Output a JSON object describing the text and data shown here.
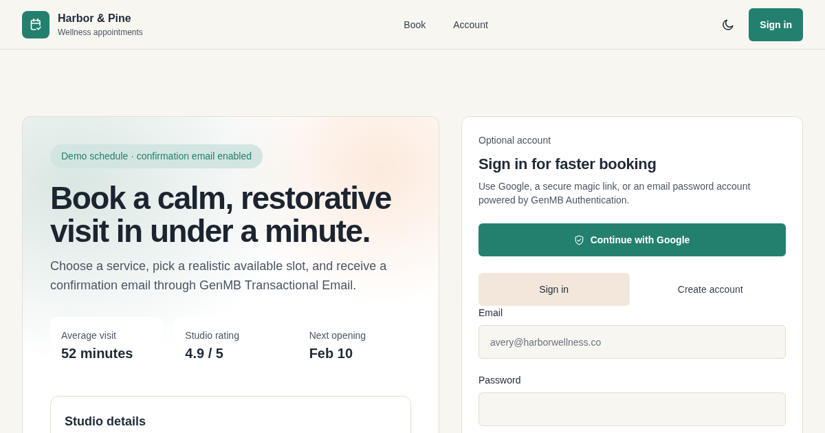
{
  "header": {
    "brand": {
      "name": "Harbor & Pine",
      "tagline": "Wellness appointments"
    },
    "nav": [
      "Book",
      "Account"
    ],
    "sign_in_button": "Sign in"
  },
  "hero": {
    "badge": "Demo schedule · confirmation email enabled",
    "headline": "Book a calm, restorative visit in under a minute.",
    "intro": "Choose a service, pick a realistic available slot, and receive a confirmation email through GenMB Transactional Email.",
    "stats": [
      {
        "label": "Average visit",
        "value": "52 minutes"
      },
      {
        "label": "Studio rating",
        "value": "4.9 / 5"
      },
      {
        "label": "Next opening",
        "value": "Feb 10"
      }
    ],
    "details_card": {
      "title": "Studio details"
    }
  },
  "auth": {
    "eyebrow": "Optional account",
    "title": "Sign in for faster booking",
    "description": "Use Google, a secure magic link, or an email password account powered by GenMB Authentication.",
    "google_button": "Continue with Google",
    "tabs": [
      {
        "label": "Sign in",
        "selected": true
      },
      {
        "label": "Create account",
        "selected": false
      }
    ],
    "fields": [
      {
        "label": "Email",
        "placeholder": "avery@harborwellness.co"
      },
      {
        "label": "Password"
      }
    ]
  }
}
